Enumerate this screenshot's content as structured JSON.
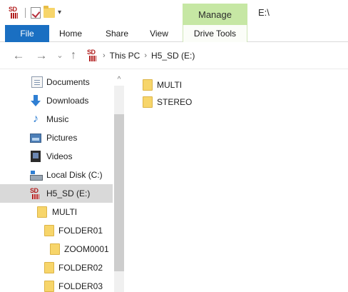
{
  "window": {
    "title": "E:\\",
    "contextual_tab": "Manage"
  },
  "quick_access_toolbar": {
    "dropdown_glyph": "▾",
    "app_icon": "sd-card-icon",
    "app_icon_text": "SD"
  },
  "ribbon": {
    "tabs": [
      "File",
      "Home",
      "Share",
      "View",
      "Drive Tools"
    ],
    "active_tab": "File",
    "accent_color": "#1a6fc2",
    "contextual_color": "#c6e7a4"
  },
  "nav": {
    "back": "←",
    "forward": "→",
    "recent": "⌄",
    "up": "↑"
  },
  "breadcrumb": {
    "items": [
      "This PC",
      "H5_SD (E:)"
    ],
    "separator": "›"
  },
  "nav_pane": {
    "items": [
      {
        "label": "Documents",
        "icon": "documents-icon"
      },
      {
        "label": "Downloads",
        "icon": "downloads-icon"
      },
      {
        "label": "Music",
        "icon": "music-icon"
      },
      {
        "label": "Pictures",
        "icon": "pictures-icon"
      },
      {
        "label": "Videos",
        "icon": "videos-icon"
      },
      {
        "label": "Local Disk (C:)",
        "icon": "local-disk-icon"
      },
      {
        "label": "H5_SD (E:)",
        "icon": "sd-card-icon",
        "selected": true
      },
      {
        "label": "MULTI",
        "icon": "folder-icon"
      },
      {
        "label": "FOLDER01",
        "icon": "folder-icon"
      },
      {
        "label": "ZOOM0001",
        "icon": "folder-icon"
      },
      {
        "label": "FOLDER02",
        "icon": "folder-icon"
      },
      {
        "label": "FOLDER03",
        "icon": "folder-icon"
      }
    ],
    "scroll_up_glyph": "^"
  },
  "content": {
    "items": [
      {
        "label": "MULTI",
        "icon": "folder-icon"
      },
      {
        "label": "STEREO",
        "icon": "folder-icon"
      }
    ]
  }
}
